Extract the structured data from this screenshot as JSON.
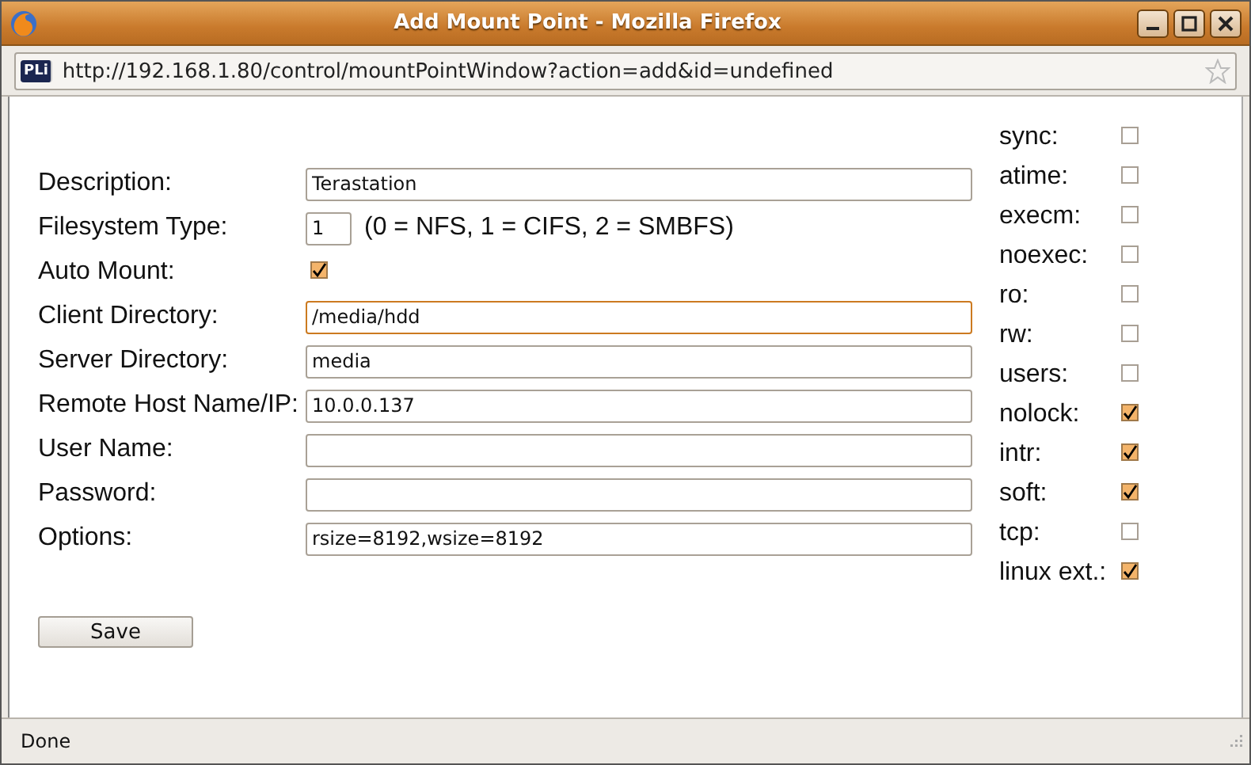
{
  "window": {
    "title": "Add Mount Point - Mozilla Firefox"
  },
  "address_bar": {
    "site_badge": "PLi",
    "url": "http://192.168.1.80/control/mountPointWindow?action=add&id=undefined"
  },
  "form": {
    "fields": [
      {
        "kind": "text",
        "label": "Description:",
        "value": "Terastation",
        "focused": false
      },
      {
        "kind": "short",
        "label": "Filesystem Type:",
        "value": "1",
        "note": "(0 = NFS, 1 = CIFS, 2 = SMBFS)",
        "focused": false
      },
      {
        "kind": "check",
        "label": "Auto Mount:",
        "checked": true
      },
      {
        "kind": "text",
        "label": "Client Directory:",
        "value": "/media/hdd",
        "focused": true
      },
      {
        "kind": "text",
        "label": "Server Directory:",
        "value": "media",
        "focused": false
      },
      {
        "kind": "text",
        "label": "Remote Host Name/IP:",
        "value": "10.0.0.137",
        "focused": false
      },
      {
        "kind": "text",
        "label": "User Name:",
        "focused": false
      },
      {
        "kind": "text",
        "label": "Password:",
        "focused": false
      },
      {
        "kind": "text",
        "label": "Options:",
        "value": "rsize=8192,wsize=8192",
        "focused": false
      }
    ]
  },
  "options": [
    {
      "label": "sync:",
      "checked": false
    },
    {
      "label": "atime:",
      "checked": false
    },
    {
      "label": "execm:",
      "checked": false
    },
    {
      "label": "noexec:",
      "checked": false
    },
    {
      "label": "ro:",
      "checked": false
    },
    {
      "label": "rw:",
      "checked": false
    },
    {
      "label": "users:",
      "checked": false
    },
    {
      "label": "nolock:",
      "checked": true
    },
    {
      "label": "intr:",
      "checked": true
    },
    {
      "label": "soft:",
      "checked": true
    },
    {
      "label": "tcp:",
      "checked": false
    },
    {
      "label": "linux ext.:",
      "checked": true
    }
  ],
  "save_button": "Save",
  "status_bar": {
    "text": "Done"
  }
}
